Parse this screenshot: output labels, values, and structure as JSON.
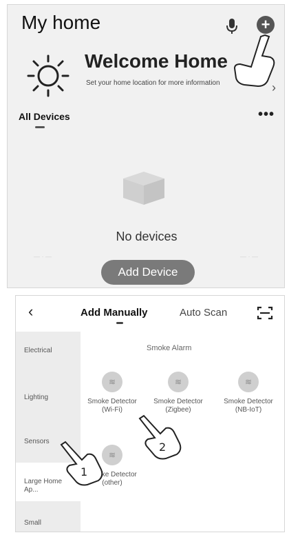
{
  "panel1": {
    "title": "My home",
    "welcome": {
      "title": "Welcome Home",
      "subtitle": "Set your home location for more information"
    },
    "all_devices_label": "All Devices",
    "empty_text": "No devices",
    "add_device_label": "Add Device",
    "icons": {
      "mic": "mic-icon",
      "plus": "plus-icon",
      "sun": "sun-icon",
      "more": "more-icon",
      "chevron": "chevron-right-icon",
      "empty": "empty-box-icon"
    }
  },
  "panel2": {
    "tabs": {
      "manual": "Add Manually",
      "scan": "Auto Scan"
    },
    "sidebar": [
      {
        "label": "Electrical"
      },
      {
        "label": "Lighting"
      },
      {
        "label": "Sensors"
      },
      {
        "label": "Large Home Ap..."
      },
      {
        "label": "Small"
      }
    ],
    "section_title": "Smoke Alarm",
    "devices": [
      {
        "name": "Smoke Detector",
        "proto": "(Wi-Fi)"
      },
      {
        "name": "Smoke Detector",
        "proto": "(Zigbee)"
      },
      {
        "name": "Smoke Detector",
        "proto": "(NB-IoT)"
      },
      {
        "name": "Smoke Detector",
        "proto": "(other)"
      }
    ],
    "step_numbers": [
      "1",
      "2"
    ],
    "icons": {
      "back": "back-icon",
      "scan": "scan-icon",
      "device": "smoke-detector-icon"
    }
  },
  "colors": {
    "panel_bg": "#f1f1f1",
    "button_bg": "#7a7a7a",
    "sidebar_bg": "#ececec",
    "device_icon_bg": "#cfcfcf"
  }
}
